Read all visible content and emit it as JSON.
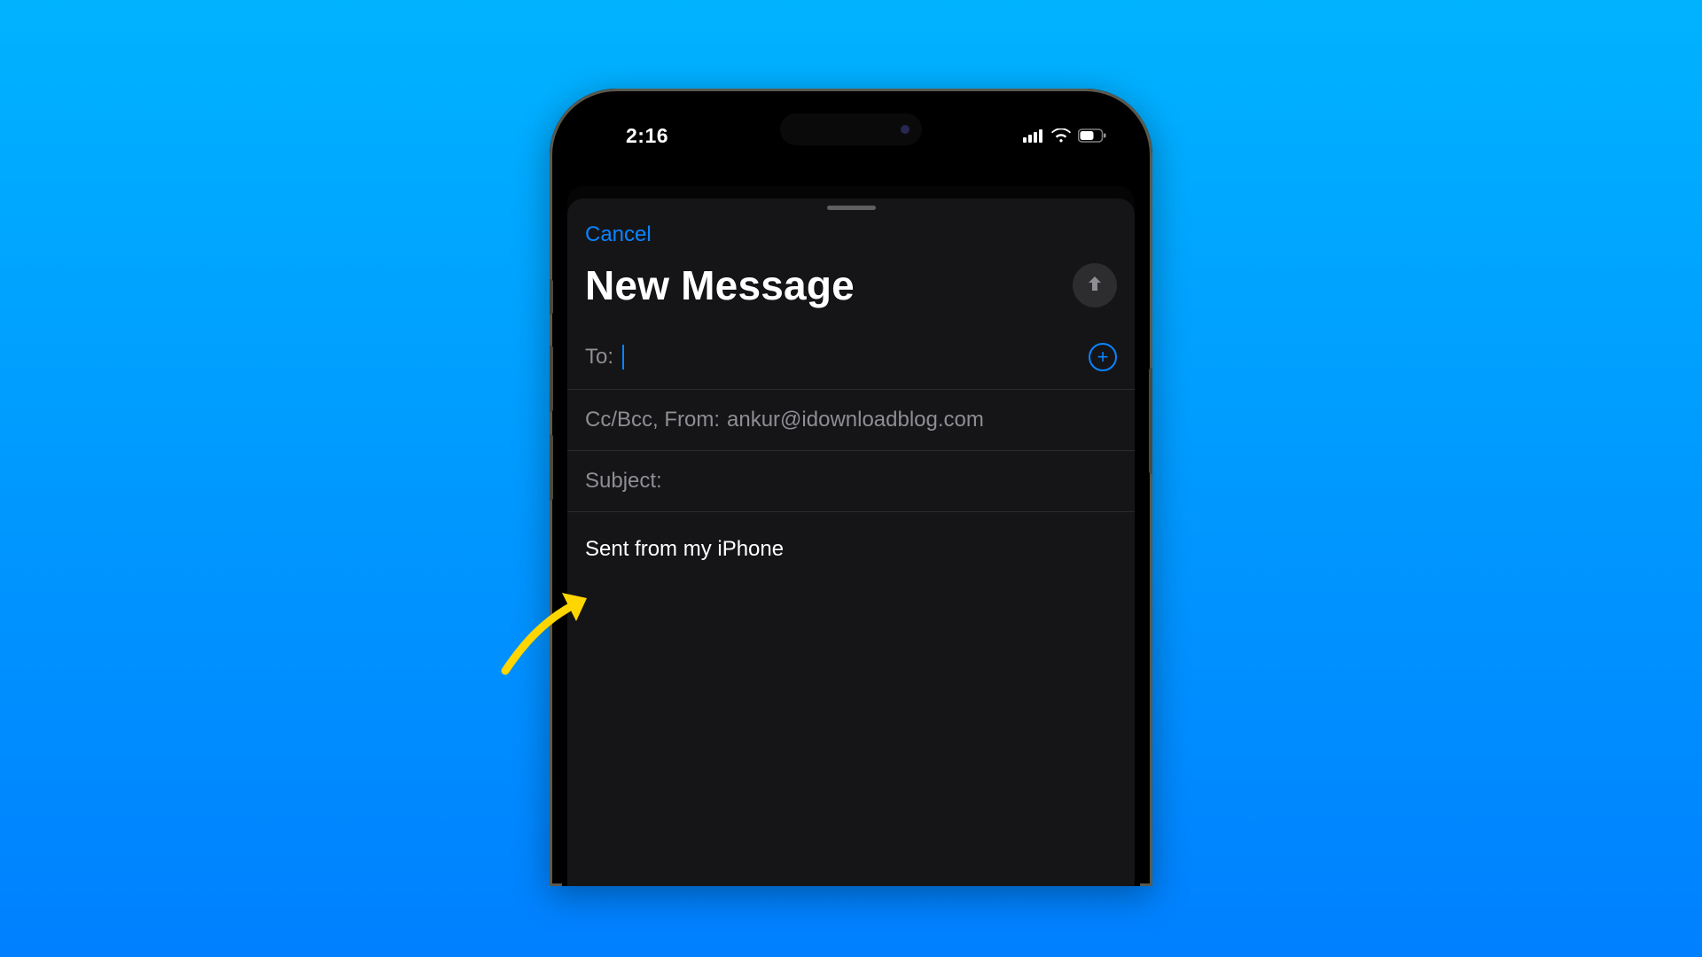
{
  "statusbar": {
    "time": "2:16"
  },
  "compose": {
    "cancel_label": "Cancel",
    "title": "New Message",
    "to_label": "To:",
    "to_value": "",
    "ccbcc_label": "Cc/Bcc, From:",
    "from_address": "ankur@idownloadblog.com",
    "subject_label": "Subject:",
    "subject_value": "",
    "signature": "Sent from my iPhone"
  },
  "colors": {
    "accent": "#0a84ff",
    "annotation": "#ffd600"
  }
}
